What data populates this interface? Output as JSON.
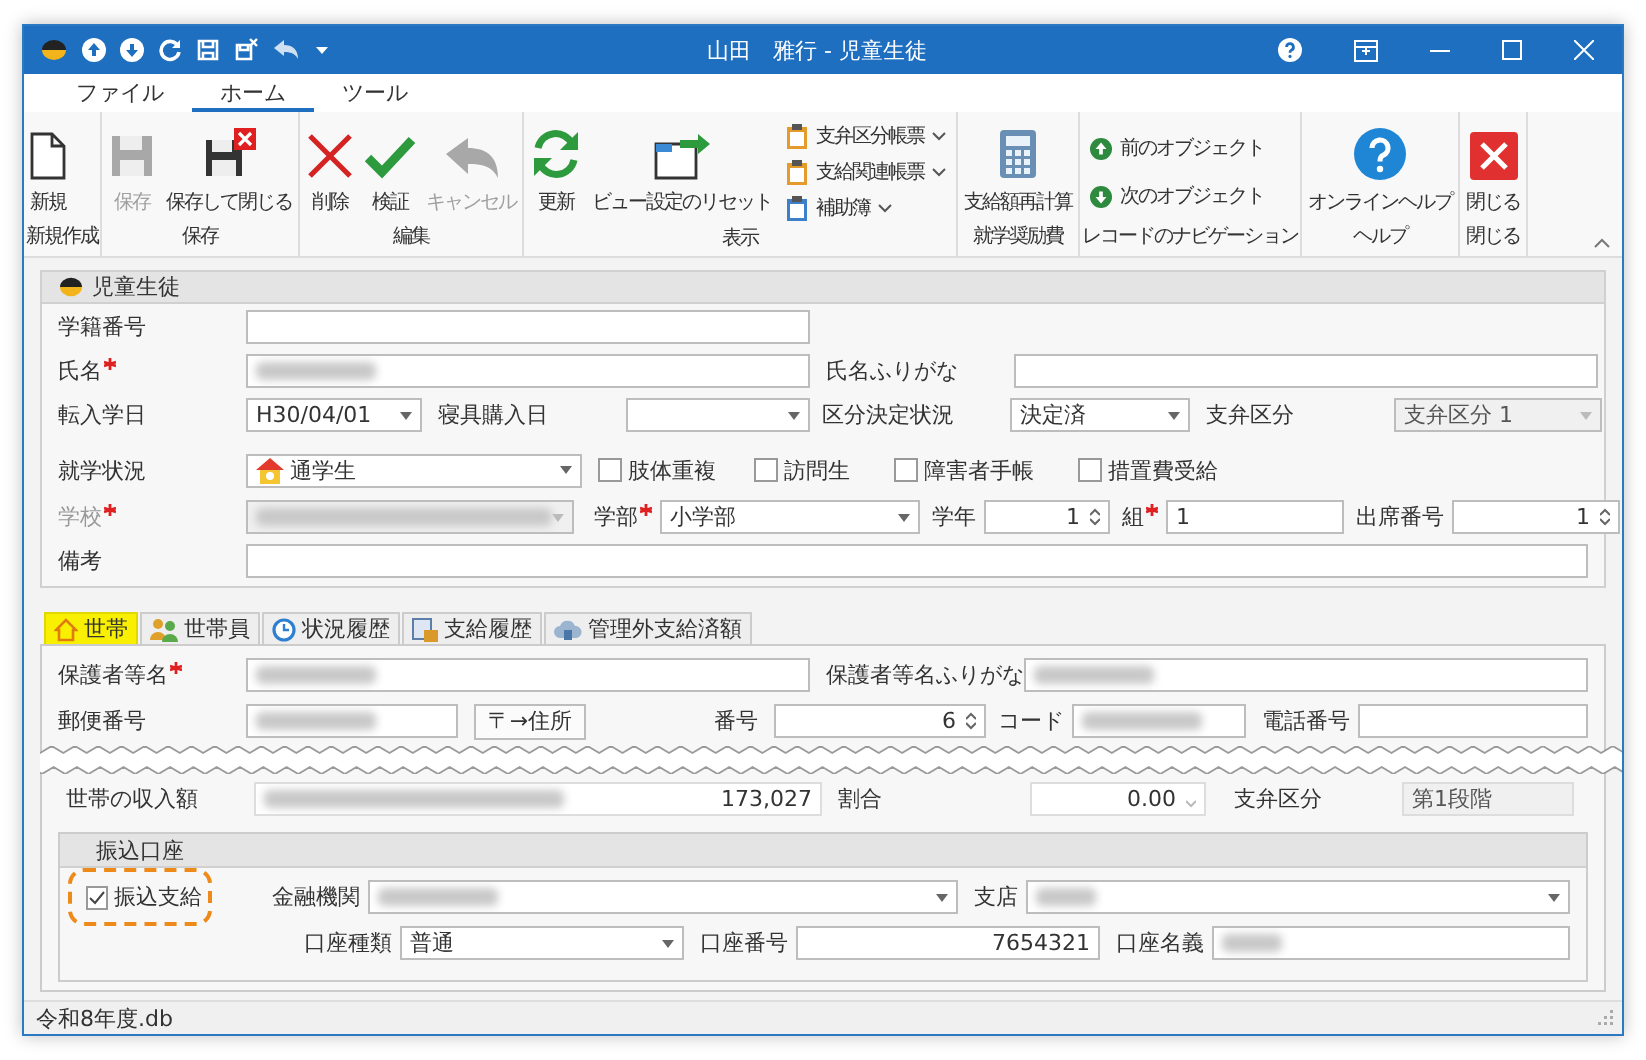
{
  "window": {
    "title": "山田　雅行 - 児童生徒"
  },
  "menu_tabs": [
    {
      "label": "ファイル",
      "selected": false
    },
    {
      "label": "ホーム",
      "selected": true
    },
    {
      "label": "ツール",
      "selected": false
    }
  ],
  "ribbon": [
    {
      "label": "新規作成",
      "buttons": [
        {
          "label": "新規",
          "kind": "large",
          "disabled": false
        }
      ]
    },
    {
      "label": "保存",
      "buttons": [
        {
          "label": "保存",
          "kind": "large",
          "disabled": true
        },
        {
          "label": "保存して閉じる",
          "kind": "large",
          "disabled": false
        }
      ]
    },
    {
      "label": "編集",
      "buttons": [
        {
          "label": "削除",
          "kind": "large",
          "disabled": false
        },
        {
          "label": "検証",
          "kind": "large",
          "disabled": false
        },
        {
          "label": "キャンセル",
          "kind": "large",
          "disabled": true
        }
      ]
    },
    {
      "label": "表示",
      "buttons": [
        {
          "label": "更新",
          "kind": "large",
          "disabled": false
        },
        {
          "label": "ビュー設定のリセット",
          "kind": "large",
          "disabled": false
        },
        {
          "label": "支弁区分帳票",
          "kind": "small",
          "disabled": false,
          "dropdown": true
        },
        {
          "label": "支給関連帳票",
          "kind": "small",
          "disabled": false,
          "dropdown": true
        },
        {
          "label": "補助簿",
          "kind": "small",
          "disabled": false,
          "dropdown": true
        }
      ]
    },
    {
      "label": "就学奨励費",
      "buttons": [
        {
          "label": "支給額再計算",
          "kind": "large",
          "disabled": false
        }
      ]
    },
    {
      "label": "レコードのナビゲーション",
      "buttons": [
        {
          "label": "前のオブジェクト",
          "kind": "small",
          "disabled": false,
          "dropdown": false
        },
        {
          "label": "次のオブジェクト",
          "kind": "small",
          "disabled": false,
          "dropdown": false
        }
      ]
    },
    {
      "label": "ヘルプ",
      "buttons": [
        {
          "label": "オンラインヘルプ",
          "kind": "large",
          "disabled": false
        }
      ]
    },
    {
      "label": "閉じる",
      "buttons": [
        {
          "label": "閉じる",
          "kind": "large",
          "disabled": false
        }
      ]
    }
  ],
  "student": {
    "title": "児童生徒",
    "student_no": {
      "label": "学籍番号"
    },
    "name": {
      "label": "氏名",
      "required": true,
      "redacted": true
    },
    "name_kana": {
      "label": "氏名ふりがな"
    },
    "transfer_date": {
      "label": "転入学日",
      "value": "H30/04/01"
    },
    "bedding_date": {
      "label": "寝具購入日"
    },
    "decision_status": {
      "label": "区分決定状況",
      "value": "決定済"
    },
    "payment_category": {
      "label": "支弁区分",
      "value": "支弁区分 1",
      "disabled": true
    },
    "school_status": {
      "label": "就学状況",
      "value": "通学生"
    },
    "checks": [
      {
        "label": "肢体重複",
        "checked": false
      },
      {
        "label": "訪問生",
        "checked": false
      },
      {
        "label": "障害者手帳",
        "checked": false
      },
      {
        "label": "措置費受給",
        "checked": false
      }
    ],
    "school": {
      "label": "学校",
      "required": true,
      "disabled": true,
      "redacted": true
    },
    "department": {
      "label": "学部",
      "required": true,
      "value": "小学部"
    },
    "grade": {
      "label": "学年",
      "value": "1"
    },
    "class": {
      "label": "組",
      "required": true,
      "value": "1"
    },
    "attendance_no": {
      "label": "出席番号",
      "value": "1"
    },
    "remarks": {
      "label": "備考"
    }
  },
  "tabs": [
    {
      "label": "世帯",
      "selected": true
    },
    {
      "label": "世帯員",
      "selected": false
    },
    {
      "label": "状況履歴",
      "selected": false
    },
    {
      "label": "支給履歴",
      "selected": false
    },
    {
      "label": "管理外支給済額",
      "selected": false
    }
  ],
  "household": {
    "guardian_name": {
      "label": "保護者等名",
      "required": true,
      "redacted": true
    },
    "guardian_kana": {
      "label": "保護者等名ふりがな",
      "redacted": true
    },
    "postal_code": {
      "label": "郵便番号",
      "redacted": true
    },
    "address_button": "〒→住所",
    "number": {
      "label": "番号",
      "value": "6"
    },
    "code": {
      "label": "コード",
      "redacted": true
    },
    "phone": {
      "label": "電話番号"
    },
    "income": {
      "label": "世帯の収入額",
      "value": "173,027",
      "redacted": true
    },
    "ratio": {
      "label": "割合",
      "value": "0.00"
    },
    "payment_category": {
      "label": "支弁区分",
      "value": "第1段階"
    }
  },
  "bank": {
    "title": "振込口座",
    "transfer": {
      "label": "振込支給",
      "checked": true,
      "highlighted": true
    },
    "institution": {
      "label": "金融機関",
      "redacted": true
    },
    "branch": {
      "label": "支店",
      "redacted": true
    },
    "account_type": {
      "label": "口座種類",
      "value": "普通"
    },
    "account_no": {
      "label": "口座番号",
      "value": "7654321"
    },
    "account_name": {
      "label": "口座名義",
      "redacted": true
    }
  },
  "status_bar": {
    "text": "令和8年度.db"
  }
}
